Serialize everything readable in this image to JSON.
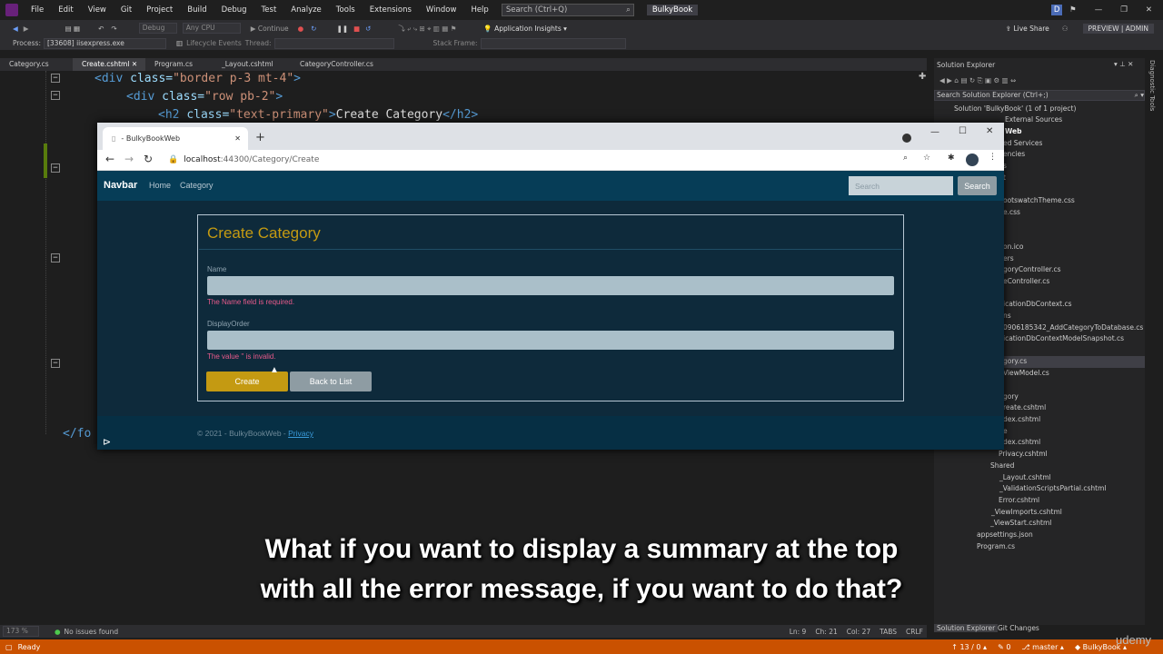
{
  "vs": {
    "menus": [
      "File",
      "Edit",
      "View",
      "Git",
      "Project",
      "Build",
      "Debug",
      "Test",
      "Analyze",
      "Tools",
      "Extensions",
      "Window",
      "Help"
    ],
    "search_placeholder": "Search (Ctrl+Q)",
    "solution_badge": "BulkyBook",
    "user_initial": "D",
    "live_share": "Live Share",
    "preview_admin": "PREVIEW | ADMIN",
    "toolbar": {
      "config": "Debug",
      "platform": "Any CPU",
      "continue": "Continue",
      "app_insights": "Application Insights"
    },
    "toolbar2": {
      "process_label": "Process:",
      "process_value": "[33608] iisexpress.exe",
      "lifecycle": "Lifecycle Events",
      "thread": "Thread:",
      "stack_frame": "Stack Frame:"
    },
    "tabs": [
      "Category.cs",
      "Create.cshtml",
      "Program.cs",
      "_Layout.cshtml",
      "CategoryController.cs"
    ],
    "code": [
      {
        "tag": "<div ",
        "attr": "class=",
        "str": "\"border p-3 mt-4\"",
        "end": ">"
      },
      {
        "tag": "<div ",
        "attr": "class=",
        "str": "\"row pb-2\"",
        "end": ">"
      },
      {
        "tag": "<h2 ",
        "attr": "class=",
        "str": "\"text-primary\"",
        "end": ">",
        "text": "Create Category",
        "close": "</h2>"
      }
    ],
    "code_closing": "</fo",
    "zoom": "173 %",
    "issues": "No issues found",
    "position": {
      "ln": "Ln: 9",
      "ch": "Ch: 21",
      "col": "Col: 27",
      "tabs": "TABS",
      "crlf": "CRLF"
    },
    "status": {
      "ready": "Ready",
      "counter": "13 / 0",
      "errors": "0",
      "branch": "master",
      "repo": "BulkyBook"
    },
    "solution_explorer": {
      "title": "Solution Explorer",
      "search": "Search Solution Explorer (Ctrl+;)",
      "rows": [
        "Solution 'BulkyBook' (1 of 1 project)",
        "External Sources",
        "Web",
        "ed Services",
        "encies",
        "s",
        "t",
        "ootswatchTheme.css",
        "e.css",
        "",
        "on.ico",
        "ers",
        "goryController.cs",
        "eController.cs",
        "",
        "icationDbContext.cs",
        "ns",
        "0906185342_AddCategoryToDatabase.cs",
        "icationDbContextModelSnapshot.cs",
        "",
        "gory.cs",
        "ViewModel.cs",
        "",
        "gory",
        "reate.cshtml",
        "dex.cshtml",
        "e",
        "dex.cshtml",
        "Privacy.cshtml",
        "Shared",
        "_Layout.cshtml",
        "_ValidationScriptsPartial.cshtml",
        "Error.cshtml",
        "_ViewImports.cshtml",
        "_ViewStart.cshtml",
        "appsettings.json",
        "Program.cs"
      ],
      "bottom_tabs": [
        "Solution Explorer",
        "Git Changes"
      ]
    },
    "side_label": "Diagnostic Tools"
  },
  "browser": {
    "tab_title": "- BulkyBookWeb",
    "url_host": "localhost",
    "url_path": ":44300/Category/Create"
  },
  "site": {
    "brand": "Navbar",
    "nav": [
      "Home",
      "Category"
    ],
    "search_placeholder": "Search",
    "search_button": "Search",
    "form_title": "Create Category",
    "name_label": "Name",
    "name_error": "The Name field is required.",
    "order_label": "DisplayOrder",
    "order_error": "The value '' is invalid.",
    "create_button": "Create",
    "back_button": "Back to List",
    "footer_text": "© 2021 - BulkyBookWeb - ",
    "footer_link": "Privacy"
  },
  "caption": {
    "line1": "What if you want to display a summary at the top",
    "line2": "with all the error message, if you want to do that?"
  },
  "udemy": "udemy",
  "colors": {
    "accent": "#c49a12",
    "status": "#ca5100",
    "nav": "#063d57"
  }
}
